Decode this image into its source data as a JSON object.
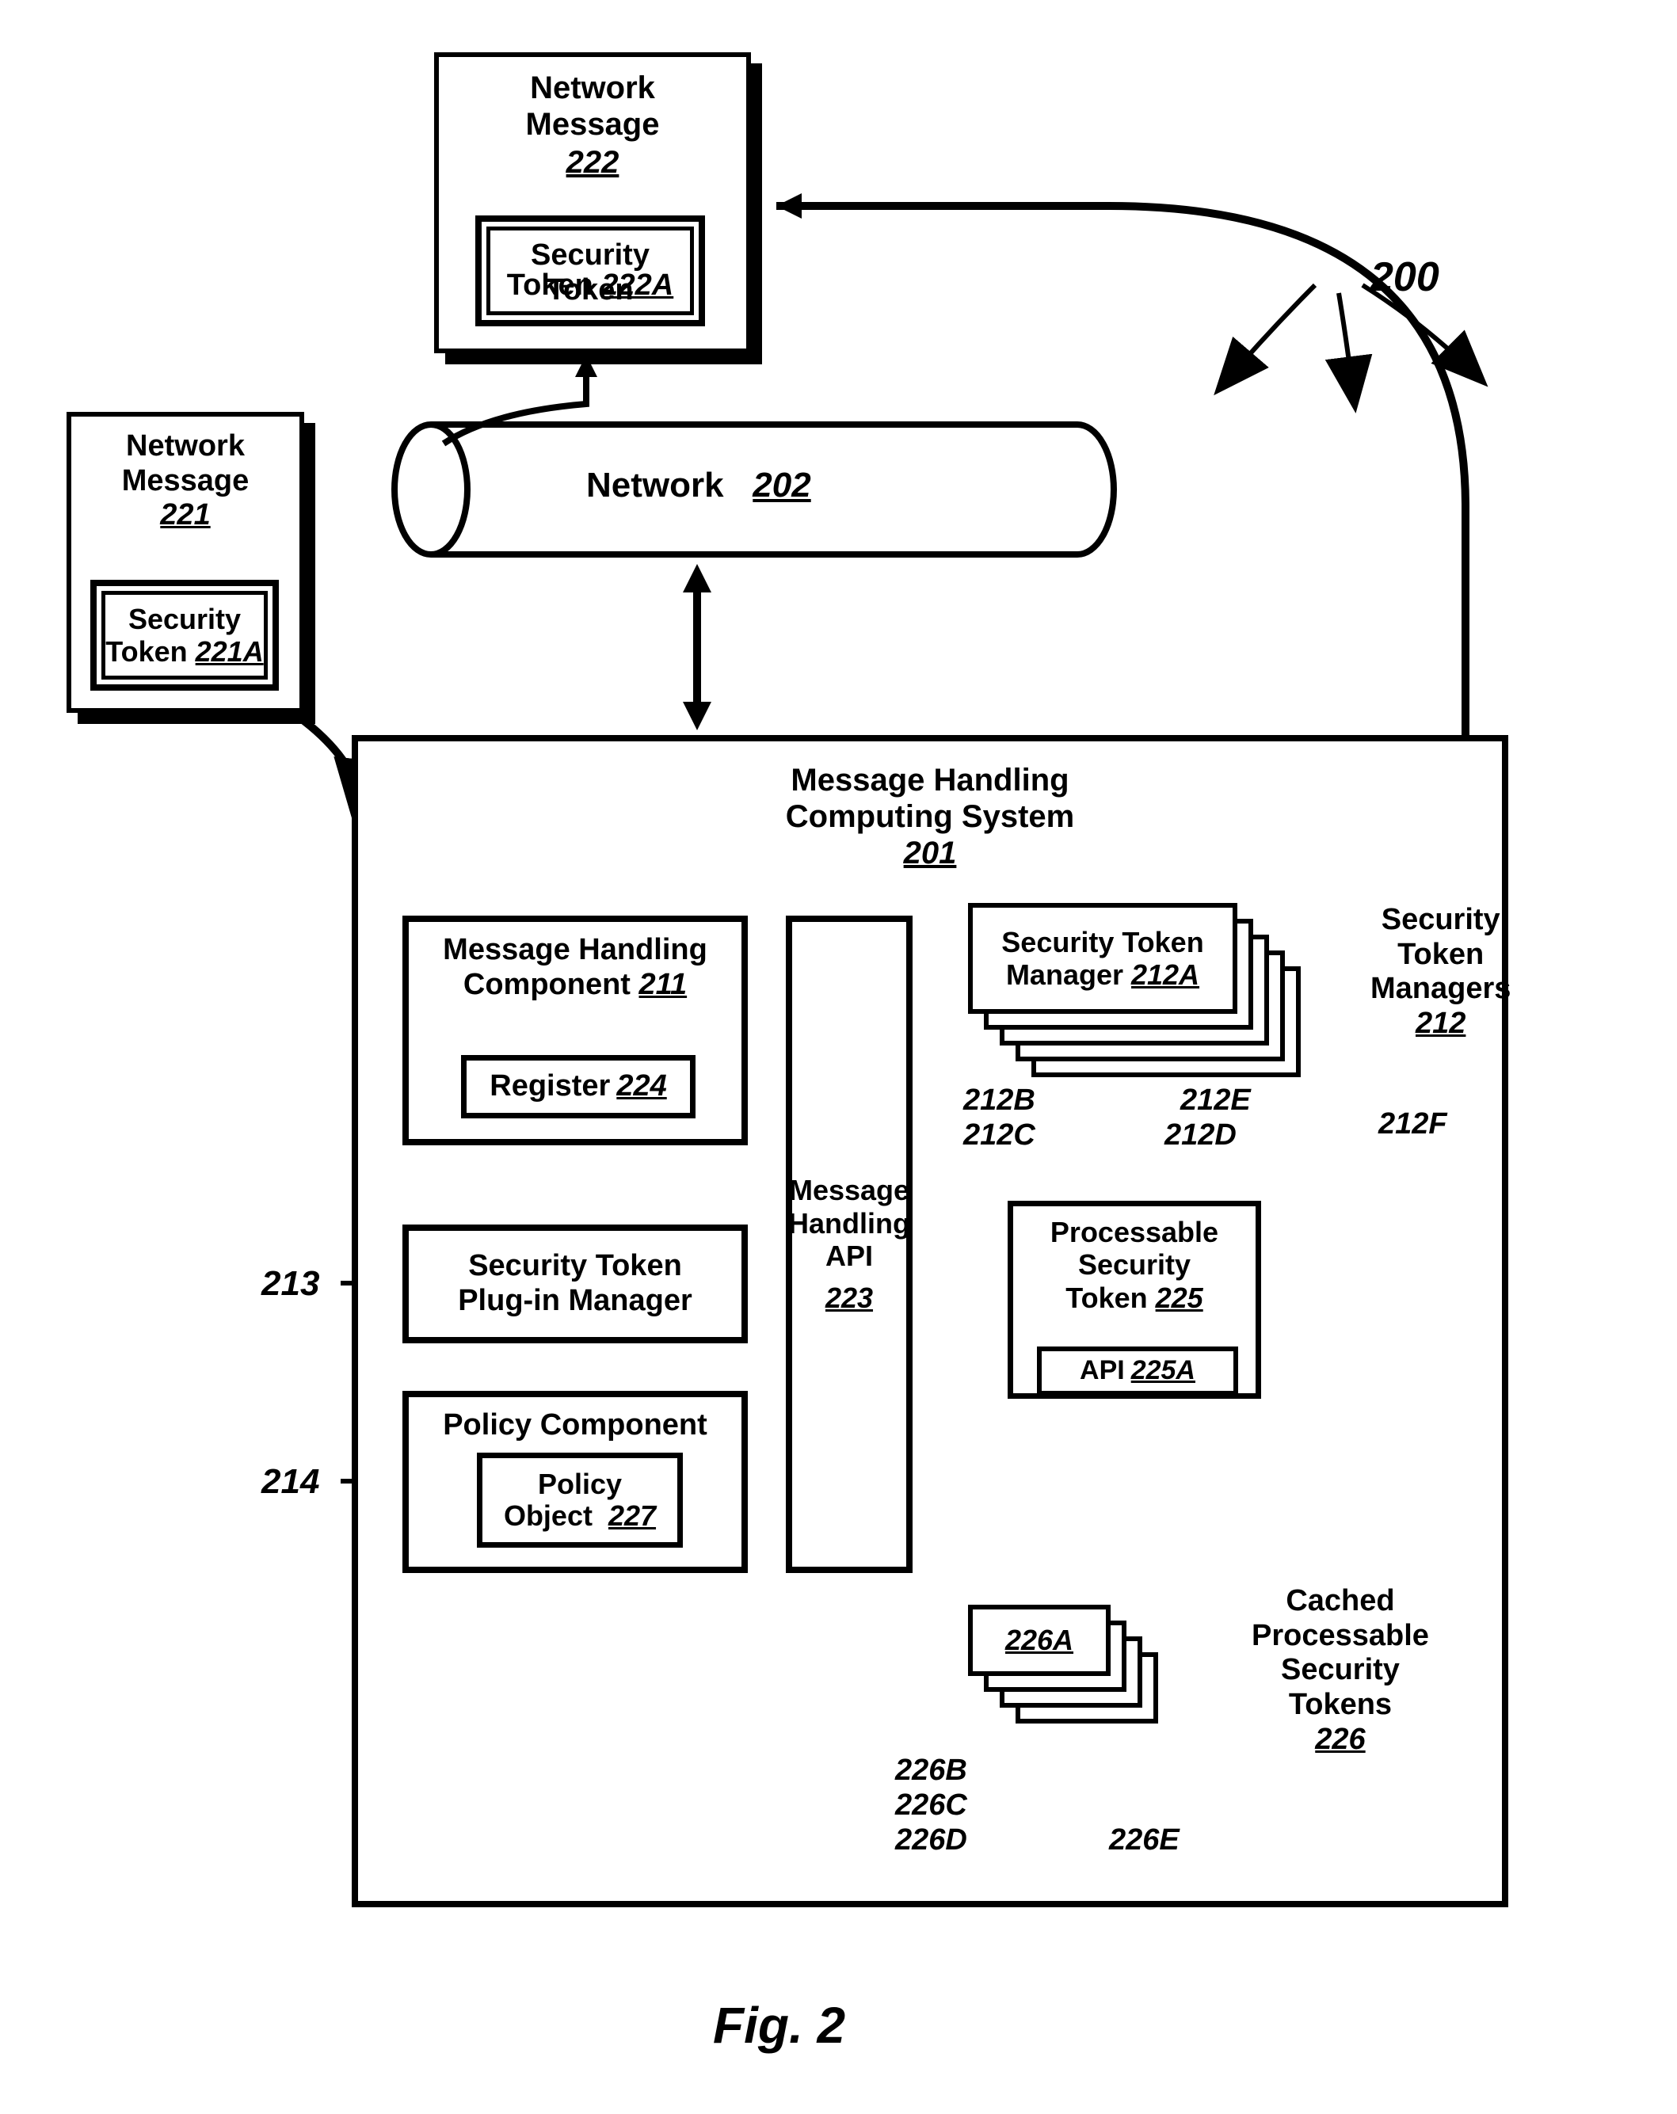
{
  "figureLabel": "Fig.  2",
  "systemRef": "200",
  "network": {
    "title": "Network",
    "ref": "202"
  },
  "msg222": {
    "title": "Network\nMessage",
    "ref": "222",
    "token": {
      "title": "Security\nToken",
      "ref": "222A"
    }
  },
  "msg221": {
    "title": "Network\nMessage",
    "ref": "221",
    "token": {
      "title": "Security\nToken",
      "ref": "221A"
    }
  },
  "system201": {
    "title": "Message Handling\nComputing System",
    "ref": "201",
    "mhc": {
      "title": "Message Handling\nComponent",
      "ref": "211",
      "register": {
        "title": "Register",
        "ref": "224"
      }
    },
    "plugin": {
      "leftRef": "213",
      "title": "Security Token\nPlug-in Manager"
    },
    "policy": {
      "leftRef": "214",
      "title": "Policy Component",
      "obj": {
        "title": "Policy\nObject",
        "ref": "227"
      }
    },
    "api": {
      "title": "Message\nHandling\nAPI",
      "ref": "223"
    },
    "stm": {
      "front": {
        "title": "Security Token\nManager",
        "ref": "212A"
      },
      "labelsLeft": [
        "212B",
        "212C"
      ],
      "labelsRight": [
        "212E",
        "212D"
      ],
      "labelFar": "212F",
      "groupLabel": "Security\nToken\nManagers",
      "groupRef": "212"
    },
    "pst": {
      "title": "Processable\nSecurity\nToken",
      "ref": "225",
      "api": {
        "title": "API",
        "ref": "225A"
      }
    },
    "cache": {
      "frontRef": "226A",
      "labelsLeft": [
        "226B",
        "226C",
        "226D"
      ],
      "labelRight": "226E",
      "groupLabel": "Cached\nProcessable\nSecurity\nTokens",
      "groupRef": "226"
    }
  }
}
